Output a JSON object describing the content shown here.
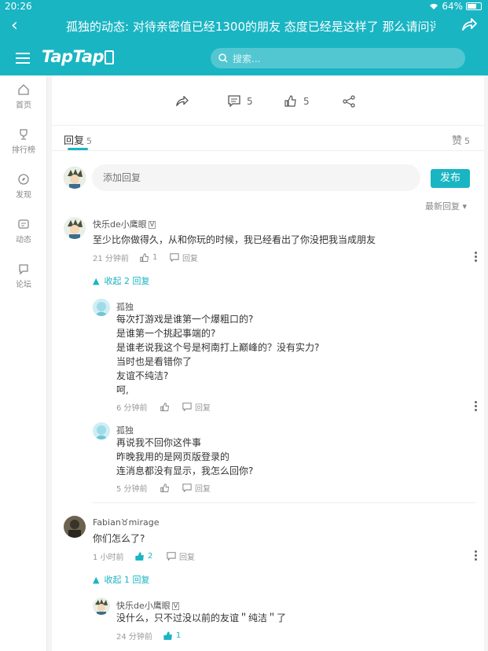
{
  "status": {
    "time": "20:26",
    "battery": "64%"
  },
  "header": {
    "title": "孤独的动态: 对待亲密值已经1300的朋友 态度已经是这样了 那么请问评...",
    "logo": "TapTap",
    "search_placeholder": "搜索..."
  },
  "sidebar": {
    "items": [
      {
        "label": "首页",
        "icon": "home-icon"
      },
      {
        "label": "排行榜",
        "icon": "trophy-icon"
      },
      {
        "label": "发现",
        "icon": "compass-icon"
      },
      {
        "label": "动态",
        "icon": "feed-icon"
      },
      {
        "label": "论坛",
        "icon": "forum-icon"
      }
    ]
  },
  "actions": {
    "comment_count": "5",
    "like_count": "5"
  },
  "tabs": {
    "reply_label": "回复",
    "reply_count": "5",
    "like_label": "赞",
    "like_count": "5"
  },
  "reply_box": {
    "placeholder": "添加回复",
    "publish_label": "发布"
  },
  "sort_label": "最新回复",
  "comments": [
    {
      "name": "快乐de小鹰眼",
      "badge": "V",
      "text": "至少比你做得久，从和你玩的时候，我已经看出了你没把我当成朋友",
      "time": "21 分钟前",
      "likes": "1",
      "reply_label": "回复",
      "collapse_label": "收起 2 回复"
    },
    {
      "name": "孤独",
      "text": "每次打游戏是谁第一个爆粗口的?\n是谁第一个挑起事端的?\n是谁老说我这个号是柯南打上巅峰的？没有实力?\n当时也是看错你了\n友谊不纯洁?\n呵,",
      "time": "6 分钟前",
      "reply_label": "回复"
    },
    {
      "name": "孤独",
      "text": "再说我不回你这件事\n昨晚我用的是网页版登录的\n连消息都没有显示，我怎么回你?",
      "time": "5 分钟前",
      "reply_label": "回复"
    },
    {
      "name": "Fabian♉mirage",
      "text": "你们怎么了?",
      "time": "1 小时前",
      "likes": "2",
      "reply_label": "回复",
      "collapse_label": "收起 1 回复"
    },
    {
      "name": "快乐de小鹰眼",
      "badge": "V",
      "text": "没什么，只不过没以前的友谊＂纯洁＂了",
      "time": "24 分钟前",
      "likes": "1"
    }
  ],
  "colors": {
    "accent": "#19b5c3"
  }
}
